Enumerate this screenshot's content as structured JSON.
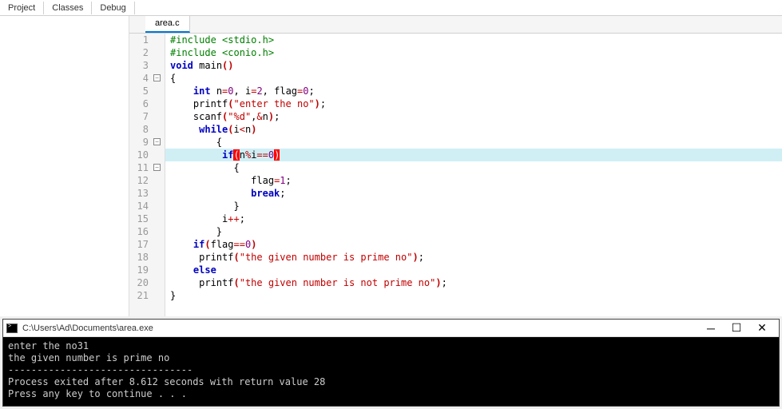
{
  "tabs": {
    "project": "Project",
    "classes": "Classes",
    "debug": "Debug"
  },
  "file_tab": "area.c",
  "line_numbers": [
    "1",
    "2",
    "3",
    "4",
    "5",
    "6",
    "7",
    "8",
    "9",
    "10",
    "11",
    "12",
    "13",
    "14",
    "15",
    "16",
    "17",
    "18",
    "19",
    "20",
    "21"
  ],
  "code": {
    "l1": {
      "inc": "#include ",
      "hdr": "<stdio.h>"
    },
    "l2": {
      "inc": "#include ",
      "hdr": "<conio.h>"
    },
    "l3": {
      "kw1": "void",
      "sp": " ",
      "fn": "main",
      "p1": "(",
      "p2": ")"
    },
    "l4": {
      "t": "{"
    },
    "l5": {
      "kw": "int",
      "rest": " n",
      "eq1": "=",
      "v1": "0",
      "c1": ", i",
      "eq2": "=",
      "v2": "2",
      "c2": ", flag",
      "eq3": "=",
      "v3": "0",
      "semi": ";"
    },
    "l6": {
      "fn": "printf",
      "p1": "(",
      "str": "\"enter the no\"",
      "p2": ")",
      "semi": ";"
    },
    "l7": {
      "fn": "scanf",
      "p1": "(",
      "str": "\"%d\"",
      "c": ",",
      "amp": "&",
      "var": "n",
      "p2": ")",
      "semi": ";"
    },
    "l8": {
      "kw": "while",
      "p1": "(",
      "cond": "i",
      "lt": "<",
      "cond2": "n",
      "p2": ")"
    },
    "l9": {
      "t": "{"
    },
    "l10": {
      "kw": "if",
      "p1": "(",
      "expr": "n",
      "mod": "%",
      "expr2": "i",
      "eq": "==",
      "zero": "0",
      "p2": ")"
    },
    "l11": {
      "t": "{"
    },
    "l12": {
      "var": "flag",
      "eq": "=",
      "val": "1",
      "semi": ";"
    },
    "l13": {
      "kw": "break",
      "semi": ";"
    },
    "l14": {
      "t": "}"
    },
    "l15": {
      "var": "i",
      "inc": "++",
      "semi": ";"
    },
    "l16": {
      "t": "}"
    },
    "l17": {
      "kw": "if",
      "p1": "(",
      "var": "flag",
      "eq": "==",
      "val": "0",
      "p2": ")"
    },
    "l18": {
      "fn": "printf",
      "p1": "(",
      "str": "\"the given number is prime no\"",
      "p2": ")",
      "semi": ";"
    },
    "l19": {
      "kw": "else"
    },
    "l20": {
      "fn": "printf",
      "p1": "(",
      "str": "\"the given number is not prime no\"",
      "p2": ")",
      "semi": ";"
    },
    "l21": {
      "t": "}"
    }
  },
  "console": {
    "title": "C:\\Users\\Ad\\Documents\\area.exe",
    "line1": "enter the no31",
    "line2": "the given number is prime no",
    "divider": "--------------------------------",
    "line3": "Process exited after 8.612 seconds with return value 28",
    "line4": "Press any key to continue . . ."
  },
  "fold_minus": "−"
}
